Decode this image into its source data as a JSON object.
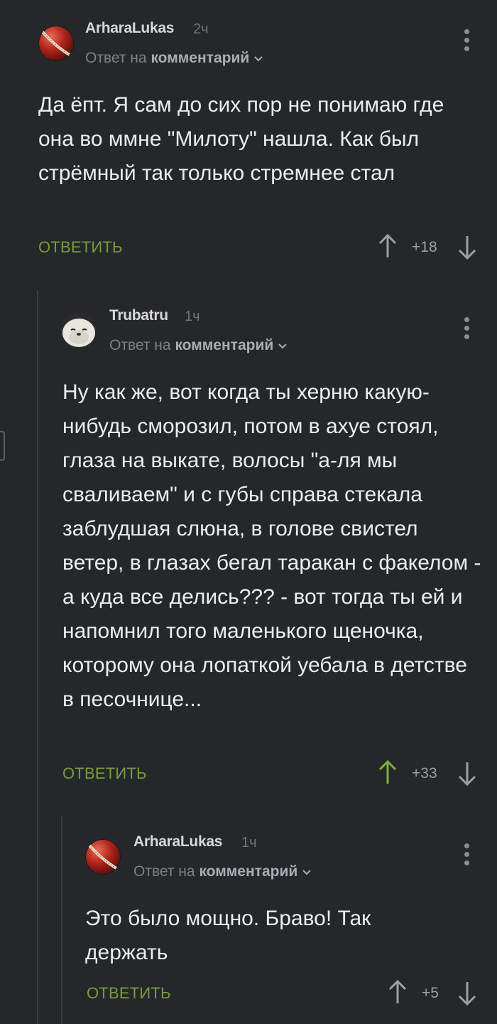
{
  "comments": [
    {
      "username": "ArharaLukas",
      "time": "2ч",
      "reply_prefix": "Ответ на",
      "reply_target": "комментарий",
      "text": "Да ёпт. Я сам до сих пор не понимаю где она во ммне \"Милоту\" нашла. Как был стрёмный так только стремнее стал",
      "reply_label": "ОТВЕТИТЬ",
      "score": "+18",
      "upvoted": false
    },
    {
      "username": "Trubatru",
      "time": "1ч",
      "reply_prefix": "Ответ на",
      "reply_target": "комментарий",
      "text": "Ну как же, вот когда ты херню какую-нибудь сморозил, потом в ахуе стоял, глаза на выкате, волосы \"а-ля мы сваливаем\" и с губы справа стекала заблудшая слюна, в голове свистел ветер, в глазах бегал таракан с факелом - а куда все делись??? -  вот тогда ты ей и напомнил того маленького щеночка, которому она лопаткой уебала в детстве в песочнице...",
      "reply_label": "ОТВЕТИТЬ",
      "score": "+33",
      "upvoted": true
    },
    {
      "username": "ArharaLukas",
      "time": "1ч",
      "reply_prefix": "Ответ на",
      "reply_target": "комментарий",
      "text": "Это было мощно. Браво! Так держать",
      "reply_label": "ОТВЕТИТЬ",
      "score": "+5",
      "upvoted": false
    }
  ],
  "colors": {
    "background": "#25282b",
    "reply_green": "#7a9a3c",
    "upvote_active": "#7ab33a",
    "arrow_inactive": "#9aa0a4"
  },
  "icons": [
    "cricket-ball-avatar",
    "seal-avatar",
    "more-vertical-icon",
    "chevron-down-icon",
    "arrow-up-icon",
    "arrow-down-icon"
  ]
}
